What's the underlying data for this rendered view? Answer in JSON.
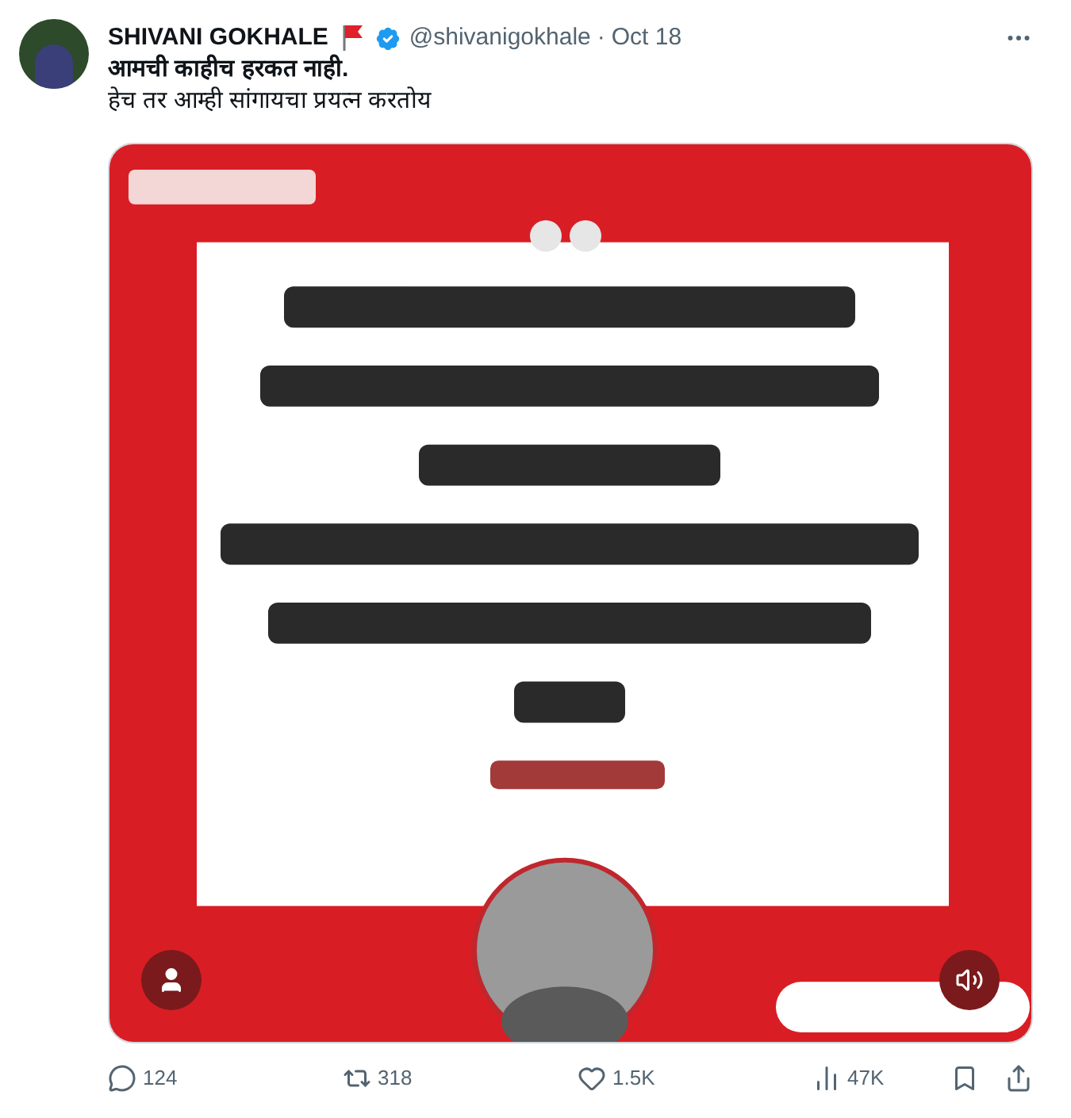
{
  "tweet": {
    "author": {
      "name": "SHIVANI GOKHALE",
      "verified": true,
      "handle": "@shivanigokhale",
      "separator": "·",
      "date": "Oct 18"
    },
    "text_lines": [
      {
        "text": "आमची काहीच हरकत नाही.",
        "bold": true
      },
      {
        "text": "हेच तर आम्ही सांगायचा प्रयत्न करतोय",
        "bold": false
      }
    ],
    "actions": [
      {
        "kind": "reply",
        "count": "124"
      },
      {
        "kind": "repost",
        "count": "318"
      },
      {
        "kind": "like",
        "count": "1.5K"
      },
      {
        "kind": "views",
        "count": "47K"
      },
      {
        "kind": "bookmark"
      },
      {
        "kind": "share"
      }
    ]
  }
}
